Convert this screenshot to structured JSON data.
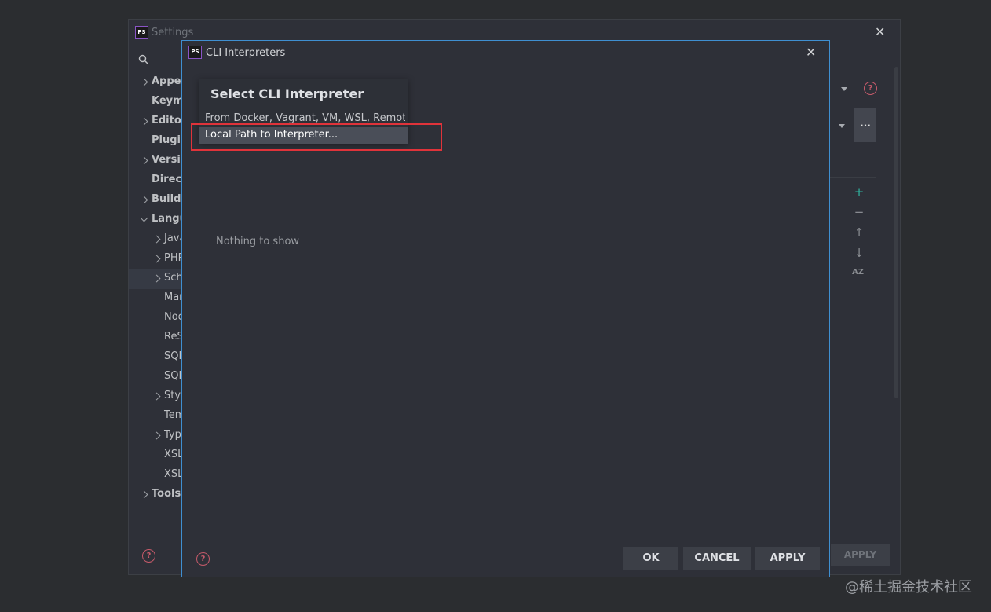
{
  "settings": {
    "title": "Settings",
    "logo_text": "PS",
    "tree": [
      {
        "label": "Appea",
        "bold": true,
        "expander": "right"
      },
      {
        "label": "Keyma",
        "bold": true,
        "expander": ""
      },
      {
        "label": "Editor",
        "bold": true,
        "expander": "right"
      },
      {
        "label": "Plugin",
        "bold": true,
        "expander": ""
      },
      {
        "label": "Versio",
        "bold": true,
        "expander": "right"
      },
      {
        "label": "Direct",
        "bold": true,
        "expander": ""
      },
      {
        "label": "Build,",
        "bold": true,
        "expander": "right"
      },
      {
        "label": "Langu",
        "bold": true,
        "expander": "down"
      },
      {
        "label": "Java",
        "bold": false,
        "expander": "right"
      },
      {
        "label": "PHP",
        "bold": false,
        "expander": "right"
      },
      {
        "label": "Sche",
        "bold": false,
        "expander": "right"
      },
      {
        "label": "Mar",
        "bold": false,
        "expander": ""
      },
      {
        "label": "Noc",
        "bold": false,
        "expander": ""
      },
      {
        "label": "ReS",
        "bold": false,
        "expander": ""
      },
      {
        "label": "SQL",
        "bold": false,
        "expander": ""
      },
      {
        "label": "SQL",
        "bold": false,
        "expander": ""
      },
      {
        "label": "Style",
        "bold": false,
        "expander": "right"
      },
      {
        "label": "Tem",
        "bold": false,
        "expander": ""
      },
      {
        "label": "Typ",
        "bold": false,
        "expander": "right"
      },
      {
        "label": "XSL",
        "bold": false,
        "expander": ""
      },
      {
        "label": "XSL",
        "bold": false,
        "expander": ""
      },
      {
        "label": "Tools",
        "bold": true,
        "expander": "right"
      }
    ],
    "dots_label": "...",
    "apply_label": "APPLY",
    "help_label": "?",
    "side_tools": [
      "+",
      "−",
      "↑",
      "↓",
      "AZ"
    ]
  },
  "dialog": {
    "title": "CLI Interpreters",
    "logo_text": "PS",
    "empty_text": "Nothing to show",
    "ok_label": "OK",
    "cancel_label": "CANCEL",
    "apply_label": "APPLY",
    "help_label": "?",
    "close_label": "✕"
  },
  "popup": {
    "title": "Select CLI Interpreter",
    "items": [
      "From Docker, Vagrant, VM, WSL, Remote...",
      "Local Path to Interpreter..."
    ]
  },
  "watermark": "@稀土掘金技术社区",
  "colors": {
    "accent_border": "#3f8fd1",
    "highlight_red": "#e0333a",
    "add_green": "#2fb3a0"
  }
}
